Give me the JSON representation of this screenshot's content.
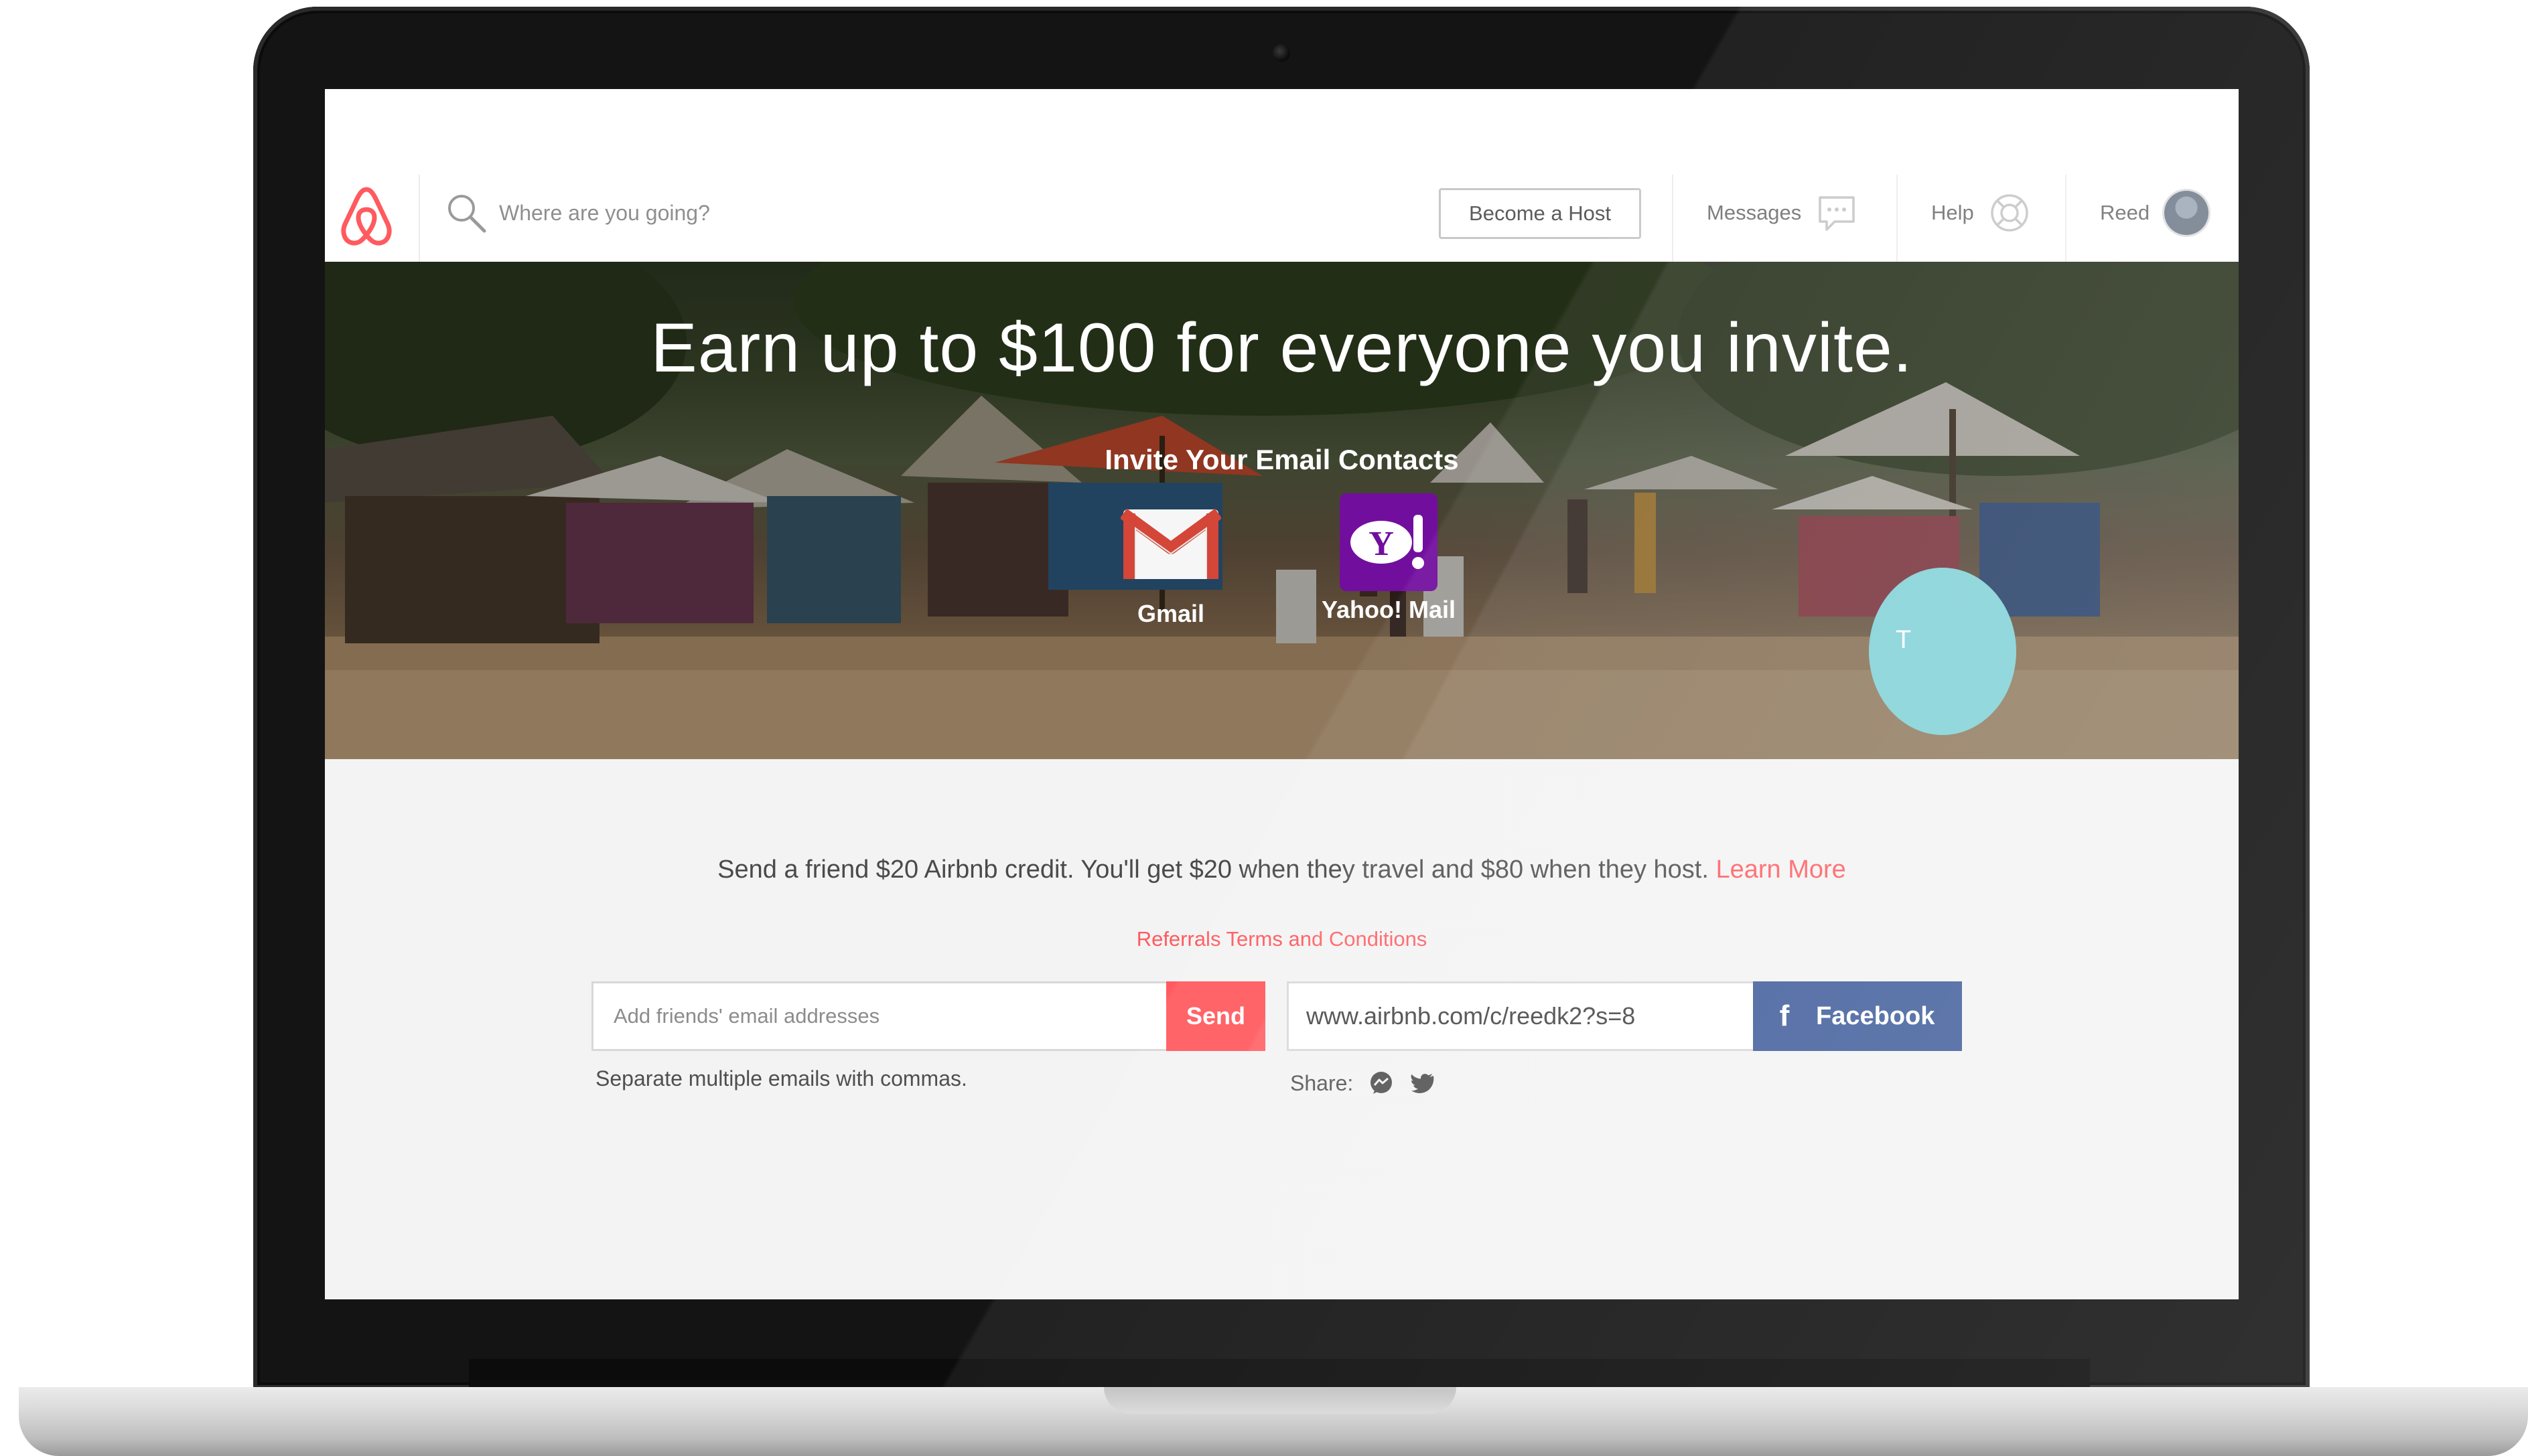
{
  "header": {
    "search_placeholder": "Where are you going?",
    "become_host": "Become a Host",
    "messages": "Messages",
    "help": "Help",
    "user_name": "Reed"
  },
  "hero": {
    "title": "Earn up to $100 for everyone you invite.",
    "subtitle": "Invite Your Email Contacts",
    "providers": [
      {
        "label": "Gmail",
        "icon": "gmail-icon"
      },
      {
        "label": "Yahoo! Mail",
        "icon": "yahoo-mail-icon"
      }
    ]
  },
  "referral": {
    "promo": "Send a friend $20 Airbnb credit. You'll get $20 when they travel and $80 when they host.",
    "learn_more": "Learn More",
    "terms": "Referrals Terms and Conditions",
    "email_placeholder": "Add friends' email addresses",
    "send": "Send",
    "helper": "Separate multiple emails with commas.",
    "share_url": "www.airbnb.com/c/reedk2?s=8",
    "facebook": "Facebook",
    "share_label": "Share:",
    "side_letter": "T"
  },
  "colors": {
    "brand": "#ff5a5f",
    "facebook": "#3b5998",
    "gmail_red": "#d44638",
    "yahoo_purple": "#720e9e",
    "side_bubble": "#7ed0d6"
  }
}
